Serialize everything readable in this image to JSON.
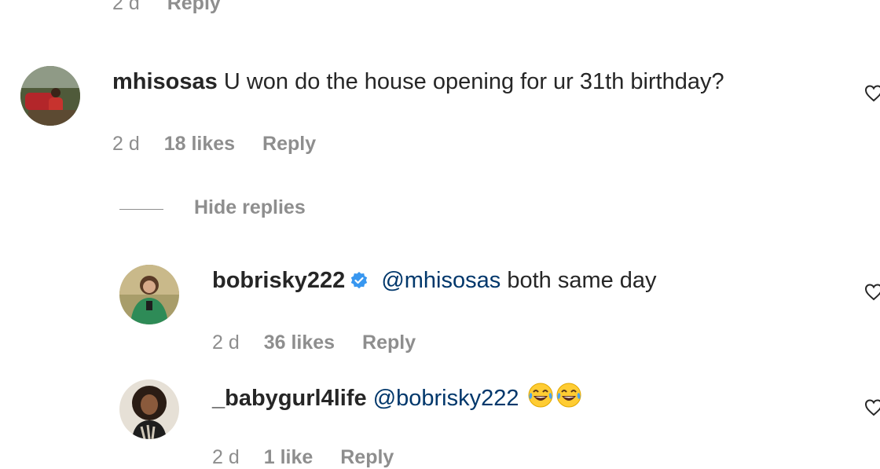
{
  "top_meta": {
    "time": "2 d",
    "reply": "Reply"
  },
  "comment": {
    "username": "mhisosas",
    "text": "U won do the house opening for ur 31th birthday?",
    "time": "2 d",
    "likes": "18 likes",
    "reply": "Reply"
  },
  "hide_replies": "Hide replies",
  "replies": [
    {
      "username": "bobrisky222",
      "verified": true,
      "mention": "@mhisosas",
      "text": "both same day",
      "time": "2 d",
      "likes": "36 likes",
      "reply": "Reply"
    },
    {
      "username": "_babygurl4life",
      "mention": "@bobrisky222",
      "emojis": [
        "tears-of-joy",
        "tears-of-joy"
      ],
      "time": "2 d",
      "likes": "1 like",
      "reply": "Reply"
    }
  ],
  "colors": {
    "meta": "#8e8e8e",
    "text": "#262626",
    "mention": "#00376b",
    "verified": "#3897f0"
  }
}
